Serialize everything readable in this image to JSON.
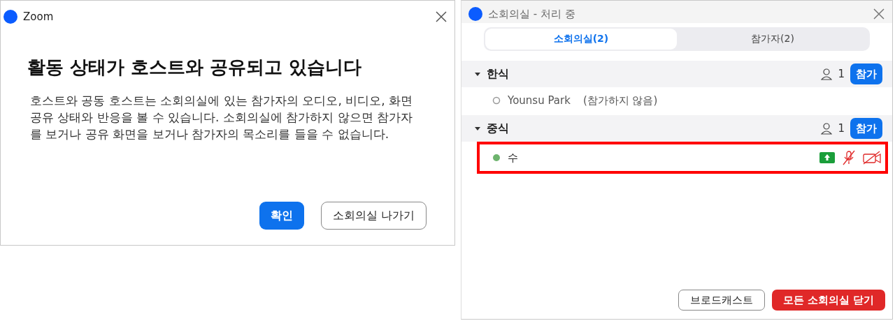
{
  "dialog": {
    "title": "Zoom",
    "heading": "활동 상태가 호스트와 공유되고 있습니다",
    "body": "호스트와 공동 호스트는 소회의실에 있는 참가자의 오디오, 비디오, 화면 공유 상태와 반응을 볼 수 있습니다. 소회의실에 참가하지 않으면 참가자를 보거나 공유 화면을 보거나 참가자의 목소리를 들을 수 없습니다.",
    "buttons": [
      {
        "label": "확인",
        "kind": "primary"
      },
      {
        "label": "소회의실 나가기",
        "kind": "secondary"
      }
    ]
  },
  "panel": {
    "title": "소회의실 - 처리 중",
    "tabs": [
      {
        "label": "소회의실(2)",
        "selected": true
      },
      {
        "label": "참가자(2)",
        "selected": false
      }
    ],
    "rooms": [
      {
        "name": "한식",
        "expanded": true,
        "count": "1",
        "join_label": "참가",
        "participants": [
          {
            "name": "Younsu Park",
            "note": "(참가하지 않음)",
            "joined": false,
            "highlighted": false,
            "sharing": false,
            "muted": false,
            "video_off": false
          }
        ]
      },
      {
        "name": "중식",
        "expanded": true,
        "count": "1",
        "join_label": "참가",
        "participants": [
          {
            "name": "수",
            "joined": true,
            "highlighted": true,
            "sharing": true,
            "muted": true,
            "video_off": true
          }
        ]
      }
    ],
    "buttons": [
      {
        "label": "브로드캐스트",
        "kind": "secondary"
      },
      {
        "label": "모든 소회의실 닫기",
        "kind": "danger"
      }
    ]
  }
}
